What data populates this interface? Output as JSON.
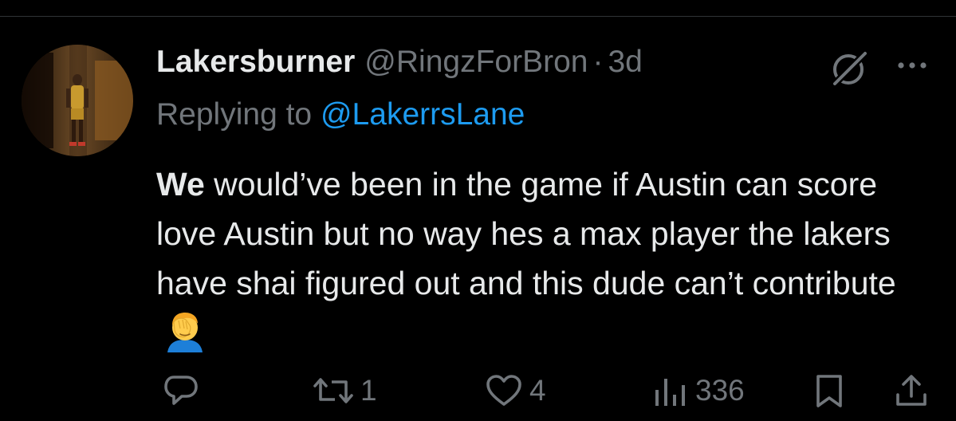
{
  "tweet": {
    "author": {
      "display_name": "Lakersburner",
      "handle": "@RingzForBron",
      "separator": "·",
      "time": "3d"
    },
    "reply": {
      "prefix": "Replying to",
      "to_handle": "@LakerrsLane"
    },
    "text": {
      "bold_start": "We",
      "rest": " would’ve been in the game if Austin can score love Austin but no way hes a max player the lakers have shai figured out and this dude can’t contribute",
      "emoji": "face-palm-emoji"
    },
    "actions": {
      "reply": {
        "icon": "reply-icon",
        "count": ""
      },
      "retweet": {
        "icon": "retweet-icon",
        "count": "1"
      },
      "like": {
        "icon": "heart-icon",
        "count": "4"
      },
      "views": {
        "icon": "views-icon",
        "count": "336"
      },
      "bookmark": {
        "icon": "bookmark-icon"
      },
      "share": {
        "icon": "share-icon"
      }
    },
    "header_icons": [
      "grok-icon",
      "more-icon"
    ]
  },
  "colors": {
    "background": "#000000",
    "text_primary": "#e7e9ea",
    "text_secondary": "#71767b",
    "link": "#1d9bf0",
    "divider": "#2f3336"
  }
}
